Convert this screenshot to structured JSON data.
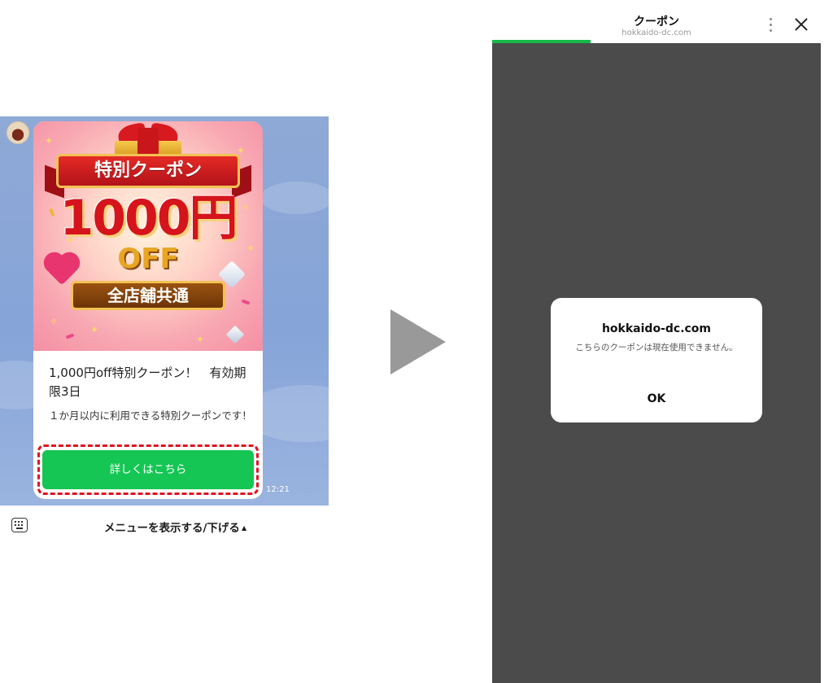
{
  "chat": {
    "avatar_icon": "shop-avatar-icon",
    "banner": {
      "title": "特別クーポン",
      "amount": "1000円",
      "off": "OFF",
      "plate": "全店舗共通"
    },
    "message_title": "1,000円off特別クーポン！　有効期限3日",
    "message_body": "１か月以内に利用できる特別クーポンです！",
    "cta_label": "詳しくはこちら",
    "timestamp": "12:21",
    "highlight_color": "#e0131f",
    "cta_color": "#15c654"
  },
  "menu_bar": {
    "keyboard_icon": "keyboard-icon",
    "label": "メニューを表示する/下げる",
    "caret": "▲"
  },
  "arrow_icon": "play-arrow-icon",
  "browser": {
    "title": "クーポン",
    "url": "hokkaido-dc.com",
    "progress": 0.3,
    "progress_color": "#14b94a",
    "dialog": {
      "title": "hokkaido-dc.com",
      "message": "こちらのクーポンは現在使用できません。",
      "ok_label": "OK"
    }
  }
}
